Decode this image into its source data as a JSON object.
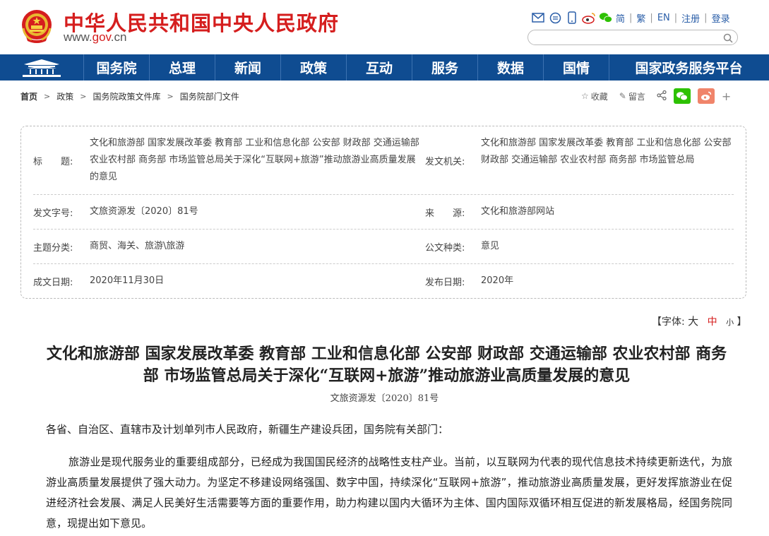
{
  "header": {
    "site_title": "中华人民共和国中央人民政府",
    "site_url_prefix": "www.",
    "site_url_gov": "gov",
    "site_url_suffix": ".cn",
    "tools": {
      "lang_simplified": "简",
      "lang_traditional": "繁",
      "lang_english": "EN",
      "register": "注册",
      "login": "登录"
    },
    "search_placeholder": "",
    "icons": [
      "mail-icon",
      "chat-icon",
      "mobile-icon",
      "weibo-icon",
      "wechat-icon",
      "search-icon"
    ]
  },
  "nav": {
    "items": [
      "国务院",
      "总理",
      "新闻",
      "政策",
      "互动",
      "服务",
      "数据",
      "国情",
      "国家政务服务平台"
    ]
  },
  "breadcrumb": {
    "items": [
      "首页",
      "政策",
      "国务院政策文件库",
      "国务院部门文件"
    ]
  },
  "actions": {
    "favorite": "收藏",
    "comment": "留言"
  },
  "info": {
    "title_label": "标　　题:",
    "title_value": "文化和旅游部 国家发展改革委 教育部 工业和信息化部 公安部 财政部 交通运输部 农业农村部 商务部 市场监管总局关于深化“互联网+旅游”推动旅游业高质量发展的意见",
    "issuer_label": "发文机关:",
    "issuer_value": "文化和旅游部 国家发展改革委 教育部 工业和信息化部 公安部 财政部 交通运输部 农业农村部 商务部 市场监管总局",
    "docno_label": "发文字号:",
    "docno_value": "文旅资源发〔2020〕81号",
    "source_label": "来　　源:",
    "source_value": "文化和旅游部网站",
    "topic_label": "主题分类:",
    "topic_value": "商贸、海关、旅游\\旅游",
    "doctype_label": "公文种类:",
    "doctype_value": "意见",
    "written_label": "成文日期:",
    "written_value": "2020年11月30日",
    "published_label": "发布日期:",
    "published_value": "2020年"
  },
  "fontsize": {
    "prefix": "【字体:",
    "big": "大",
    "mid": "中",
    "small": "小",
    "suffix": "】"
  },
  "article": {
    "title": "文化和旅游部 国家发展改革委 教育部 工业和信息化部 公安部 财政部 交通运输部 农业农村部 商务部 市场监管总局关于深化“互联网+旅游”推动旅游业高质量发展的意见",
    "doc_number": "文旅资源发〔2020〕81号",
    "salutation": "各省、自治区、直辖市及计划单列市人民政府，新疆生产建设兵团，国务院有关部门：",
    "paragraph1": "旅游业是现代服务业的重要组成部分，已经成为我国国民经济的战略性支柱产业。当前，以互联网为代表的现代信息技术持续更新迭代，为旅游业高质量发展提供了强大动力。为坚定不移建设网络强国、数字中国，持续深化“互联网+旅游”，推动旅游业高质量发展，更好发挥旅游业在促进经济社会发展、满足人民美好生活需要等方面的重要作用，助力构建以国内大循环为主体、国内国际双循环相互促进的新发展格局，经国务院同意，现提出如下意见。"
  },
  "colors": {
    "brand_red": "#d51e1e",
    "nav_blue": "#0f4c91",
    "link_blue": "#2a5ea8",
    "wechat_green": "#2dc100",
    "weibo_orange": "#f0846a"
  }
}
